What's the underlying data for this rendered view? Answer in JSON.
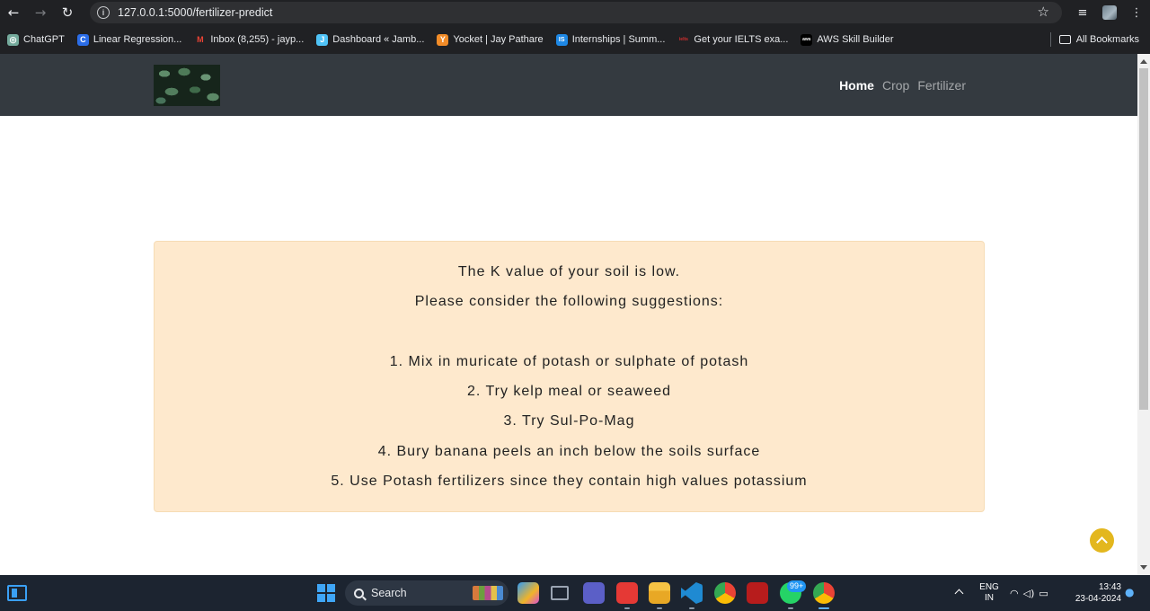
{
  "browser": {
    "url": "127.0.0.1:5000/fertilizer-predict",
    "back_glyph": "←",
    "forward_glyph": "→",
    "reload_glyph": "↻",
    "star_glyph": "☆",
    "bookmarks": [
      {
        "label": "ChatGPT",
        "icon": "chatgpt-icon",
        "color": "#74aa9c",
        "glyph": "◎"
      },
      {
        "label": "Linear Regression...",
        "icon": "c-icon",
        "color": "#2b6de8",
        "glyph": "C"
      },
      {
        "label": "Inbox (8,255) - jayp...",
        "icon": "gmail-icon",
        "color": "#ea4335",
        "glyph": "M"
      },
      {
        "label": "Dashboard « Jamb...",
        "icon": "j-icon",
        "color": "#4fc3f7",
        "glyph": "J"
      },
      {
        "label": "Yocket | Jay Pathare",
        "icon": "yocket-icon",
        "color": "#f28c28",
        "glyph": "Y"
      },
      {
        "label": "Internships | Summ...",
        "icon": "is-icon",
        "color": "#1e88e5",
        "glyph": "IS"
      },
      {
        "label": "Get your IELTS exa...",
        "icon": "ielts-icon",
        "color": "#d32f2f",
        "glyph": "ielts"
      },
      {
        "label": "AWS Skill Builder",
        "icon": "aws-icon",
        "color": "#232f3e",
        "glyph": "aws"
      }
    ],
    "all_bookmarks_label": "All Bookmarks"
  },
  "site": {
    "nav": [
      {
        "label": "Home",
        "active": true
      },
      {
        "label": "Crop",
        "active": false
      },
      {
        "label": "Fertilizer",
        "active": false
      }
    ],
    "result": {
      "heading": "The K value of your soil is low.",
      "intro": "Please consider the following suggestions:",
      "suggestions": [
        "1. Mix in muricate of potash or sulphate of potash",
        "2. Try kelp meal or seaweed",
        "3. Try Sul-Po-Mag",
        "4. Bury banana peels an inch below the soils surface",
        "5. Use Potash fertilizers since they contain high values potassium"
      ]
    }
  },
  "taskbar": {
    "search_label": "Search",
    "whatsapp_badge": "99+",
    "language": "ENG",
    "region": "IN",
    "time": "13:43",
    "date": "23-04-2024"
  }
}
